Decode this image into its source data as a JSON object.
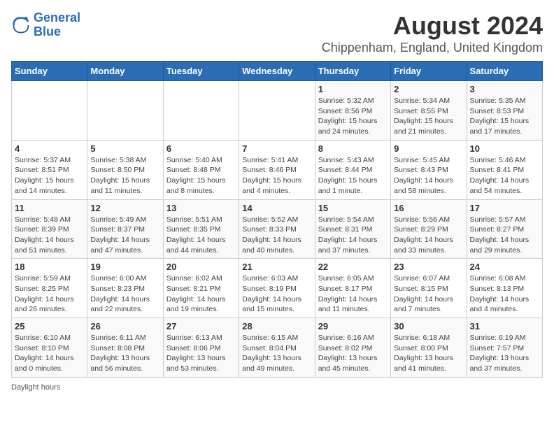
{
  "logo": {
    "line1": "General",
    "line2": "Blue"
  },
  "title": "August 2024",
  "subtitle": "Chippenham, England, United Kingdom",
  "days_of_week": [
    "Sunday",
    "Monday",
    "Tuesday",
    "Wednesday",
    "Thursday",
    "Friday",
    "Saturday"
  ],
  "footer": {
    "text": "Daylight hours",
    "url": "https://www.generalblue.com"
  },
  "weeks": [
    [
      {
        "day": "",
        "info": ""
      },
      {
        "day": "",
        "info": ""
      },
      {
        "day": "",
        "info": ""
      },
      {
        "day": "",
        "info": ""
      },
      {
        "day": "1",
        "info": "Sunrise: 5:32 AM\nSunset: 8:56 PM\nDaylight: 15 hours and 24 minutes."
      },
      {
        "day": "2",
        "info": "Sunrise: 5:34 AM\nSunset: 8:55 PM\nDaylight: 15 hours and 21 minutes."
      },
      {
        "day": "3",
        "info": "Sunrise: 5:35 AM\nSunset: 8:53 PM\nDaylight: 15 hours and 17 minutes."
      }
    ],
    [
      {
        "day": "4",
        "info": "Sunrise: 5:37 AM\nSunset: 8:51 PM\nDaylight: 15 hours and 14 minutes."
      },
      {
        "day": "5",
        "info": "Sunrise: 5:38 AM\nSunset: 8:50 PM\nDaylight: 15 hours and 11 minutes."
      },
      {
        "day": "6",
        "info": "Sunrise: 5:40 AM\nSunset: 8:48 PM\nDaylight: 15 hours and 8 minutes."
      },
      {
        "day": "7",
        "info": "Sunrise: 5:41 AM\nSunset: 8:46 PM\nDaylight: 15 hours and 4 minutes."
      },
      {
        "day": "8",
        "info": "Sunrise: 5:43 AM\nSunset: 8:44 PM\nDaylight: 15 hours and 1 minute."
      },
      {
        "day": "9",
        "info": "Sunrise: 5:45 AM\nSunset: 8:43 PM\nDaylight: 14 hours and 58 minutes."
      },
      {
        "day": "10",
        "info": "Sunrise: 5:46 AM\nSunset: 8:41 PM\nDaylight: 14 hours and 54 minutes."
      }
    ],
    [
      {
        "day": "11",
        "info": "Sunrise: 5:48 AM\nSunset: 8:39 PM\nDaylight: 14 hours and 51 minutes."
      },
      {
        "day": "12",
        "info": "Sunrise: 5:49 AM\nSunset: 8:37 PM\nDaylight: 14 hours and 47 minutes."
      },
      {
        "day": "13",
        "info": "Sunrise: 5:51 AM\nSunset: 8:35 PM\nDaylight: 14 hours and 44 minutes."
      },
      {
        "day": "14",
        "info": "Sunrise: 5:52 AM\nSunset: 8:33 PM\nDaylight: 14 hours and 40 minutes."
      },
      {
        "day": "15",
        "info": "Sunrise: 5:54 AM\nSunset: 8:31 PM\nDaylight: 14 hours and 37 minutes."
      },
      {
        "day": "16",
        "info": "Sunrise: 5:56 AM\nSunset: 8:29 PM\nDaylight: 14 hours and 33 minutes."
      },
      {
        "day": "17",
        "info": "Sunrise: 5:57 AM\nSunset: 8:27 PM\nDaylight: 14 hours and 29 minutes."
      }
    ],
    [
      {
        "day": "18",
        "info": "Sunrise: 5:59 AM\nSunset: 8:25 PM\nDaylight: 14 hours and 26 minutes."
      },
      {
        "day": "19",
        "info": "Sunrise: 6:00 AM\nSunset: 8:23 PM\nDaylight: 14 hours and 22 minutes."
      },
      {
        "day": "20",
        "info": "Sunrise: 6:02 AM\nSunset: 8:21 PM\nDaylight: 14 hours and 19 minutes."
      },
      {
        "day": "21",
        "info": "Sunrise: 6:03 AM\nSunset: 8:19 PM\nDaylight: 14 hours and 15 minutes."
      },
      {
        "day": "22",
        "info": "Sunrise: 6:05 AM\nSunset: 8:17 PM\nDaylight: 14 hours and 11 minutes."
      },
      {
        "day": "23",
        "info": "Sunrise: 6:07 AM\nSunset: 8:15 PM\nDaylight: 14 hours and 7 minutes."
      },
      {
        "day": "24",
        "info": "Sunrise: 6:08 AM\nSunset: 8:13 PM\nDaylight: 14 hours and 4 minutes."
      }
    ],
    [
      {
        "day": "25",
        "info": "Sunrise: 6:10 AM\nSunset: 8:10 PM\nDaylight: 14 hours and 0 minutes."
      },
      {
        "day": "26",
        "info": "Sunrise: 6:11 AM\nSunset: 8:08 PM\nDaylight: 13 hours and 56 minutes."
      },
      {
        "day": "27",
        "info": "Sunrise: 6:13 AM\nSunset: 8:06 PM\nDaylight: 13 hours and 53 minutes."
      },
      {
        "day": "28",
        "info": "Sunrise: 6:15 AM\nSunset: 8:04 PM\nDaylight: 13 hours and 49 minutes."
      },
      {
        "day": "29",
        "info": "Sunrise: 6:16 AM\nSunset: 8:02 PM\nDaylight: 13 hours and 45 minutes."
      },
      {
        "day": "30",
        "info": "Sunrise: 6:18 AM\nSunset: 8:00 PM\nDaylight: 13 hours and 41 minutes."
      },
      {
        "day": "31",
        "info": "Sunrise: 6:19 AM\nSunset: 7:57 PM\nDaylight: 13 hours and 37 minutes."
      }
    ]
  ]
}
